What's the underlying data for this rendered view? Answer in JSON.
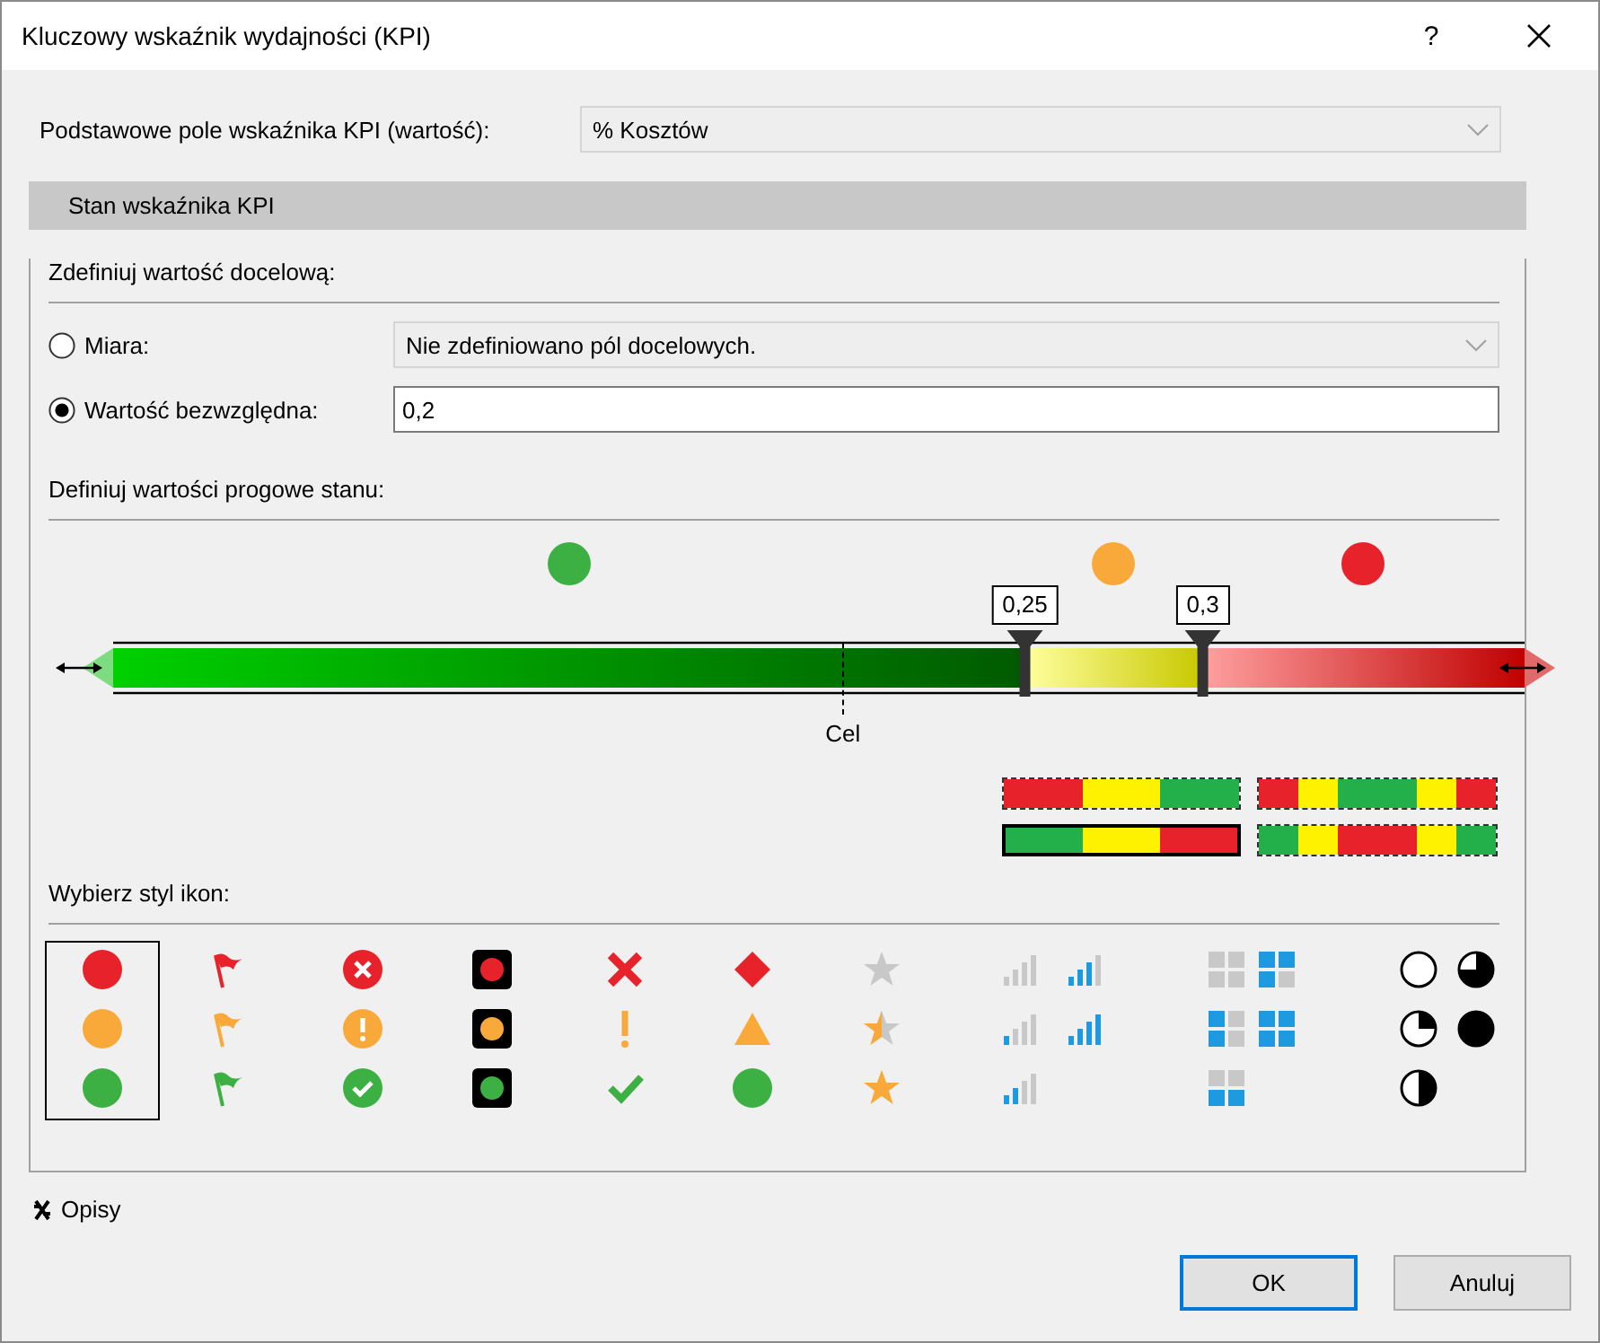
{
  "window": {
    "title": "Kluczowy wskaźnik wydajności (KPI)",
    "help": "?"
  },
  "base_field": {
    "label": "Podstawowe pole wskaźnika KPI (wartość):",
    "value": "% Kosztów"
  },
  "section": {
    "title": "Stan wskaźnika KPI"
  },
  "target": {
    "heading": "Zdefiniuj wartość docelową:",
    "options": [
      {
        "label": "Miara:",
        "kind": "dropdown",
        "value": "Nie zdefiniowano pól docelowych.",
        "selected": false
      },
      {
        "label": "Wartość bezwzględna:",
        "kind": "text",
        "value": "0,2",
        "selected": true
      }
    ]
  },
  "thresholds": {
    "heading": "Definiuj wartości progowe stanu:",
    "bands": [
      {
        "kind": "good",
        "color": "#3cb043"
      },
      {
        "kind": "warning",
        "color": "#f9a93a"
      },
      {
        "kind": "bad",
        "color": "#e8222a"
      }
    ],
    "markers": [
      {
        "value": "0,25",
        "level": 0.646
      },
      {
        "value": "0,3",
        "level": 0.772
      }
    ],
    "target": {
      "label": "Cel",
      "level": 0.517
    },
    "color_schemes": [
      {
        "segments": [
          {
            "color": "#e8222a"
          },
          {
            "color": "#fff200"
          },
          {
            "color": "#23b04b"
          }
        ],
        "selected": false
      },
      {
        "segments": [
          {
            "color": "#e8222a"
          },
          {
            "color": "#fff200"
          },
          {
            "color": "#23b04b"
          },
          {
            "color": "#23b04b"
          },
          {
            "color": "#fff200"
          },
          {
            "color": "#e8222a"
          }
        ],
        "selected": false
      },
      {
        "segments": [
          {
            "color": "#23b04b"
          },
          {
            "color": "#fff200"
          },
          {
            "color": "#e8222a"
          }
        ],
        "selected": true
      },
      {
        "segments": [
          {
            "color": "#23b04b"
          },
          {
            "color": "#fff200"
          },
          {
            "color": "#e8222a"
          },
          {
            "color": "#e8222a"
          },
          {
            "color": "#fff200"
          },
          {
            "color": "#23b04b"
          }
        ],
        "selected": false
      }
    ]
  },
  "icon_styles": {
    "heading": "Wybierz styl ikon:",
    "sets": [
      {
        "kind": "circles",
        "selected": true
      },
      {
        "kind": "flags",
        "selected": false
      },
      {
        "kind": "circled-symbols",
        "selected": false
      },
      {
        "kind": "lights",
        "selected": false
      },
      {
        "kind": "symbols",
        "selected": false
      },
      {
        "kind": "shapes",
        "selected": false
      },
      {
        "kind": "stars",
        "selected": false
      },
      {
        "kind": "bars-3",
        "selected": false
      },
      {
        "kind": "bars-5",
        "selected": false
      },
      {
        "kind": "boxes-3",
        "selected": false
      },
      {
        "kind": "boxes-5",
        "selected": false
      },
      {
        "kind": "pies-3",
        "selected": false
      },
      {
        "kind": "pies-5",
        "selected": false
      }
    ]
  },
  "descriptions": {
    "label": "Opisy"
  },
  "buttons": [
    {
      "label": "OK",
      "kind": "default"
    },
    {
      "label": "Anuluj",
      "kind": "normal"
    }
  ]
}
